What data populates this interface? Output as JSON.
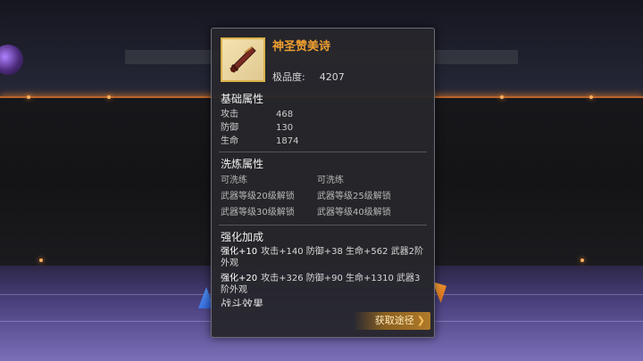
{
  "item": {
    "name": "神圣赞美诗",
    "quality_label": "极品度:",
    "quality_value": "4207"
  },
  "base_stats": {
    "title": "基础属性",
    "rows": [
      {
        "label": "攻击",
        "value": "468"
      },
      {
        "label": "防御",
        "value": "130"
      },
      {
        "label": "生命",
        "value": "1874"
      }
    ]
  },
  "refine": {
    "title": "洗炼属性",
    "slots": [
      "可洗练",
      "可洗练",
      "武器等级20级解锁",
      "武器等级25级解锁",
      "武器等级30级解锁",
      "武器等级40级解锁"
    ]
  },
  "enhance": {
    "title": "强化加成",
    "entries": [
      {
        "level": "强化+10",
        "text": "攻击+140 防御+38 生命+562 武器2阶外观"
      },
      {
        "level": "强化+20",
        "text": "攻击+326 防御+90 生命+1310 武器3阶外观"
      }
    ]
  },
  "battle_effect_title": "战斗效果",
  "get_button": {
    "label": "获取途径",
    "chevron": "❯"
  },
  "icons": [
    "weapon-icon",
    "chevron-right-icon"
  ],
  "colors": {
    "item_name": "#f0a030",
    "accent_border": "#d9b24a",
    "button": "#b07a2a"
  }
}
